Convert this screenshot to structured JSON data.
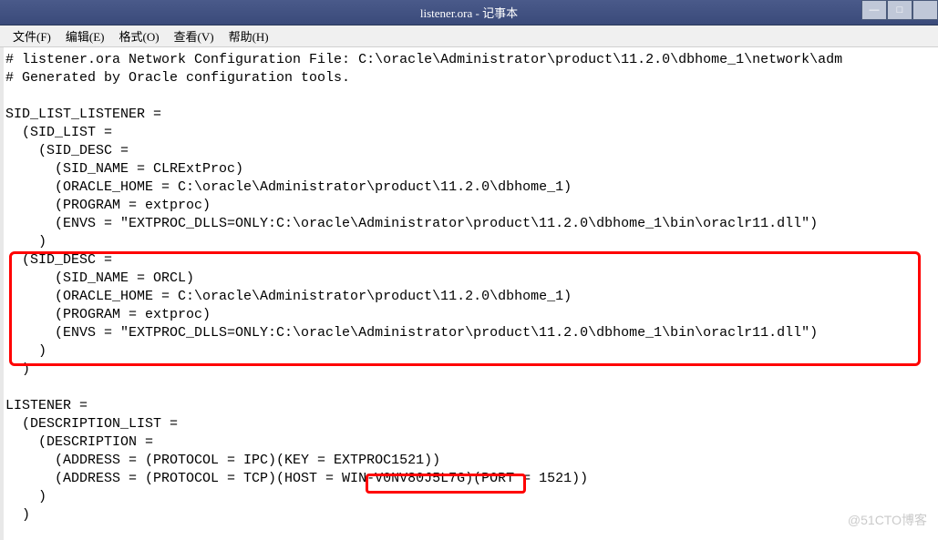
{
  "window": {
    "title": "listener.ora - 记事本",
    "controls": {
      "minimize": "—",
      "maximize": "□",
      "close": ""
    }
  },
  "menu": {
    "file": "文件(F)",
    "edit": "编辑(E)",
    "format": "格式(O)",
    "view": "查看(V)",
    "help": "帮助(H)"
  },
  "file_content": {
    "line01": "# listener.ora Network Configuration File: C:\\oracle\\Administrator\\product\\11.2.0\\dbhome_1\\network\\adm",
    "line02": "# Generated by Oracle configuration tools.",
    "line03": "",
    "line04": "SID_LIST_LISTENER =",
    "line05": "  (SID_LIST =",
    "line06": "    (SID_DESC =",
    "line07": "      (SID_NAME = CLRExtProc)",
    "line08": "      (ORACLE_HOME = C:\\oracle\\Administrator\\product\\11.2.0\\dbhome_1)",
    "line09": "      (PROGRAM = extproc)",
    "line10": "      (ENVS = \"EXTPROC_DLLS=ONLY:C:\\oracle\\Administrator\\product\\11.2.0\\dbhome_1\\bin\\oraclr11.dll\")",
    "line11": "    )",
    "line12": "  (SID_DESC =",
    "line13": "      (SID_NAME = ORCL)",
    "line14": "      (ORACLE_HOME = C:\\oracle\\Administrator\\product\\11.2.0\\dbhome_1)",
    "line15": "      (PROGRAM = extproc)",
    "line16": "      (ENVS = \"EXTPROC_DLLS=ONLY:C:\\oracle\\Administrator\\product\\11.2.0\\dbhome_1\\bin\\oraclr11.dll\")",
    "line17": "    )",
    "line18": "  )",
    "line19": "",
    "line20": "LISTENER =",
    "line21": "  (DESCRIPTION_LIST =",
    "line22": "    (DESCRIPTION =",
    "line23": "      (ADDRESS = (PROTOCOL = IPC)(KEY = EXTPROC1521))",
    "line24": "      (ADDRESS = (PROTOCOL = TCP)(HOST = WIN-V0NV80J5L7G)(PORT = 1521))",
    "line25": "    )",
    "line26": "  )"
  },
  "watermark": "@51CTO博客"
}
